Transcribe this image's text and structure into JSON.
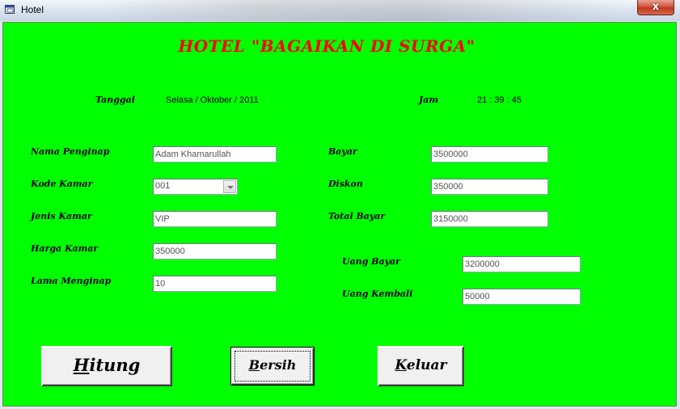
{
  "window": {
    "title": "Hotel",
    "close_glyph": "x",
    "icon": "window-app-icon"
  },
  "form": {
    "heading": "HOTEL \"BAGAIKAN DI SURGA\"",
    "date_label": "Tanggal",
    "date_value": "Selasa / Oktober / 2011",
    "time_label": "Jam",
    "time_value": "21 : 39 : 45",
    "left_fields": {
      "guest_name": {
        "label": "Nama Penginap",
        "value": "Adam Khamarullah"
      },
      "room_code": {
        "label": "Kode Kamar",
        "value": "001"
      },
      "room_type": {
        "label": "Jenis Kamar",
        "value": "VIP"
      },
      "room_price": {
        "label": "Harga Kamar",
        "value": "350000"
      },
      "stay_length": {
        "label": "Lama Menginap",
        "value": "10"
      }
    },
    "right_fields": {
      "pay": {
        "label": "Bayar",
        "value": "3500000"
      },
      "discount": {
        "label": "Diskon",
        "value": "350000"
      },
      "total_pay": {
        "label": "Total Bayar",
        "value": "3150000"
      },
      "cash_paid": {
        "label": "Uang Bayar",
        "value": "3200000"
      },
      "change": {
        "label": "Uang Kembali",
        "value": "50000"
      }
    },
    "buttons": {
      "hitung": {
        "hotkey": "H",
        "rest": "itung"
      },
      "bersih": {
        "hotkey": "B",
        "rest": "ersih"
      },
      "keluar": {
        "hotkey": "K",
        "rest": "eluar"
      }
    },
    "colors": {
      "background": "#00ff00",
      "heading": "#ff0000"
    }
  }
}
